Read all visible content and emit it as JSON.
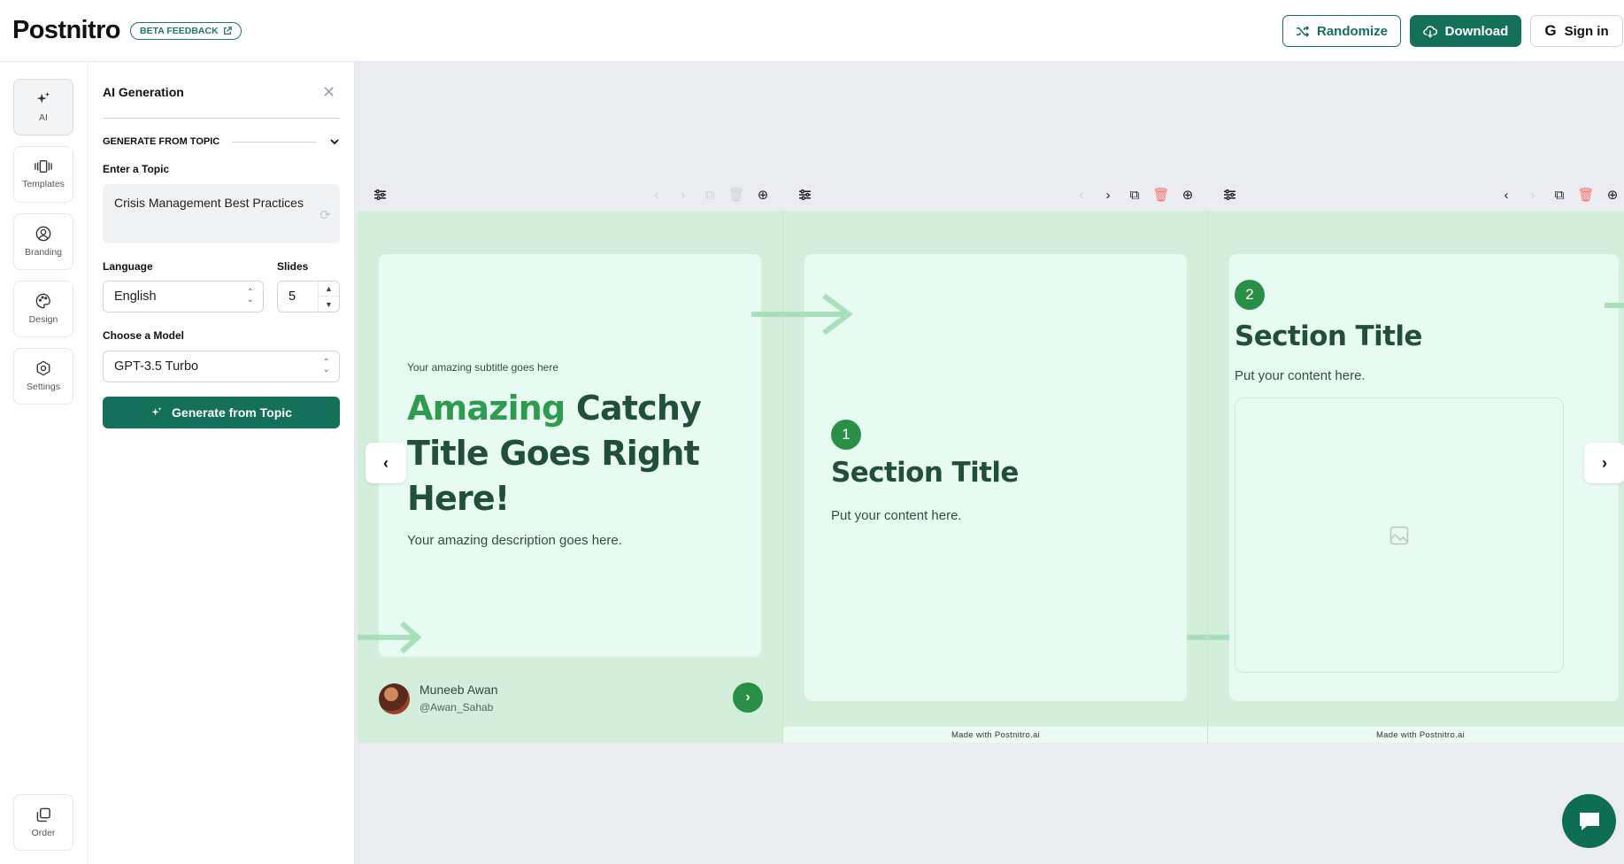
{
  "header": {
    "logo": "Postnitro",
    "beta_label": "BETA FEEDBACK",
    "randomize_label": "Randomize",
    "download_label": "Download",
    "signin_label": "Sign in",
    "brand_color": "#14705a"
  },
  "rail": {
    "items": [
      {
        "label": "AI",
        "icon": "sparkles-icon"
      },
      {
        "label": "Templates",
        "icon": "carousel-icon"
      },
      {
        "label": "Branding",
        "icon": "user-circle-icon"
      },
      {
        "label": "Design",
        "icon": "palette-icon"
      },
      {
        "label": "Settings",
        "icon": "hexagon-gear-icon"
      }
    ],
    "order_label": "Order"
  },
  "panel": {
    "title": "AI Generation",
    "section": "GENERATE FROM TOPIC",
    "topic_label": "Enter a Topic",
    "topic_value": "Crisis Management Best Practices",
    "language_label": "Language",
    "language_value": "English",
    "slides_label": "Slides",
    "slides_value": "5",
    "model_label": "Choose a Model",
    "model_value": "GPT-3.5 Turbo",
    "generate_label": "Generate from Topic"
  },
  "slides": {
    "intro": {
      "subtitle": "Your amazing subtitle goes here",
      "title_accent": "Amazing",
      "title_rest": " Catchy Title Goes Right Here!",
      "description": "Your amazing description goes here.",
      "author_name": "Muneeb Awan",
      "author_handle": "@Awan_Sahab"
    },
    "section1": {
      "number": "1",
      "title": "Section Title",
      "content": "Put your content here.",
      "footer": "Made with Postnitro.ai"
    },
    "section2": {
      "number": "2",
      "title": "Section Title",
      "content": "Put your content here.",
      "footer": "Made with Postnitro.ai"
    }
  },
  "colors": {
    "slide_bg": "#d3efdb",
    "card_bg": "#e7fbf3",
    "heading": "#224f37",
    "accent": "#2e9b4f",
    "delete_red": "#f87171"
  }
}
